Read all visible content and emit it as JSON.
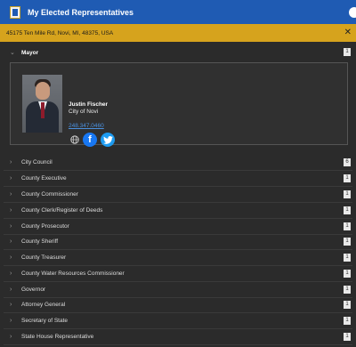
{
  "app": {
    "title": "My Elected Representatives",
    "address": "45175 Ten Mile Rd, Novi, MI, 48375, USA"
  },
  "mayor": {
    "section_label": "Mayor",
    "count": "1",
    "name": "Justin Fischer",
    "org": "City of Novi",
    "phone": "248.347.0460"
  },
  "sections": [
    {
      "label": "City Council",
      "count": "6"
    },
    {
      "label": "County Executive",
      "count": "1"
    },
    {
      "label": "County Commissioner",
      "count": "1"
    },
    {
      "label": "County Clerk/Register of Deeds",
      "count": "1"
    },
    {
      "label": "County Prosecutor",
      "count": "1"
    },
    {
      "label": "County Sheriff",
      "count": "1"
    },
    {
      "label": "County Treasurer",
      "count": "1"
    },
    {
      "label": "County Water Resources Commissioner",
      "count": "1"
    },
    {
      "label": "Governor",
      "count": "1"
    },
    {
      "label": "Attorney General",
      "count": "1"
    },
    {
      "label": "Secretary of State",
      "count": "1"
    },
    {
      "label": "State House Representative",
      "count": "1"
    }
  ],
  "icons": {
    "header": "city-seal-icon",
    "close": "close-icon",
    "expand": "chevron-down-icon",
    "collapsed": "chevron-right-icon",
    "website": "globe-icon",
    "facebook": "facebook-icon",
    "twitter": "twitter-icon"
  },
  "colors": {
    "header_bg": "#1f5bb3",
    "address_bg": "#d6a31d",
    "panel_bg": "#2b2b2b",
    "link": "#4a8fdc"
  }
}
